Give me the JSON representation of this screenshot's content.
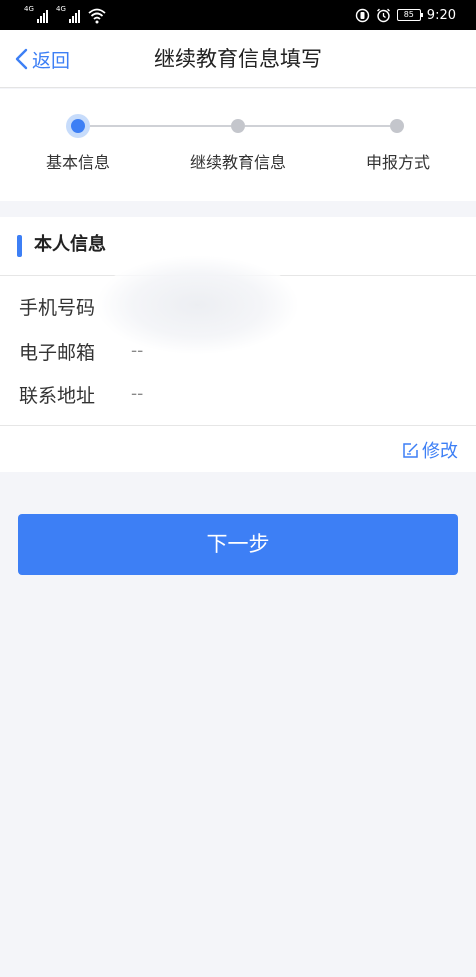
{
  "status_bar": {
    "signal1_tag": "4G",
    "signal2_tag": "4G",
    "battery": "85",
    "time": "9:20"
  },
  "nav": {
    "back_label": "返回",
    "title": "继续教育信息填写"
  },
  "steps": [
    {
      "label": "基本信息",
      "state": "active"
    },
    {
      "label": "继续教育信息",
      "state": "pending"
    },
    {
      "label": "申报方式",
      "state": "pending"
    }
  ],
  "section": {
    "title": "本人信息",
    "fields": [
      {
        "label": "手机号码",
        "value": ""
      },
      {
        "label": "电子邮箱",
        "value": "--"
      },
      {
        "label": "联系地址",
        "value": "--"
      }
    ],
    "edit_label": "修改"
  },
  "next_button": "下一步",
  "colors": {
    "accent": "#3d7ff5",
    "page_background": "#f4f5f9",
    "inactive_step": "#c4c6cc"
  },
  "icons": [
    "signal-icon",
    "wifi-icon",
    "vibrate-icon",
    "alarm-icon",
    "battery-icon",
    "back-chevron-icon",
    "edit-icon"
  ]
}
